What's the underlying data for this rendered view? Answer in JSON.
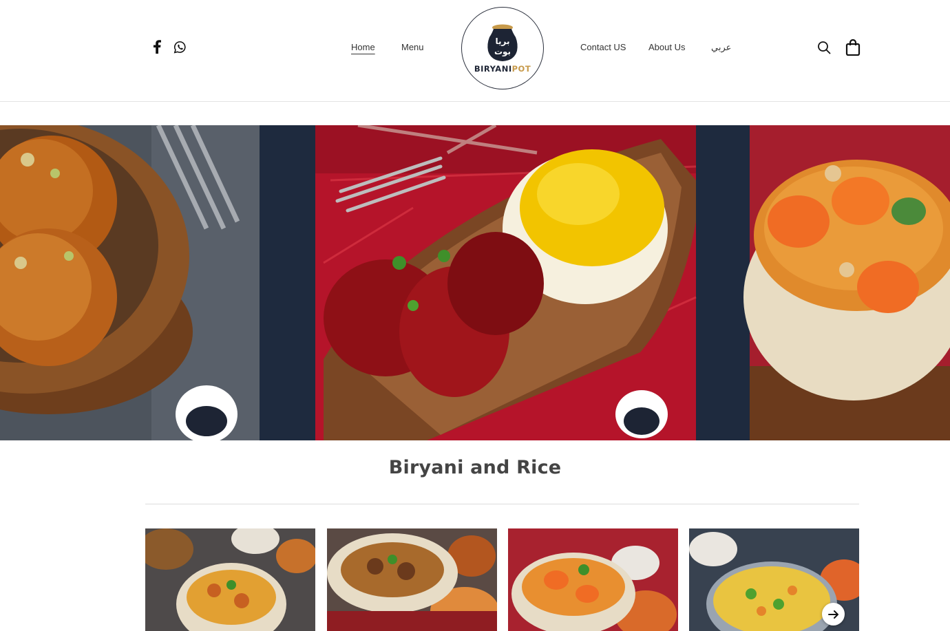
{
  "header": {
    "social": [
      {
        "icon": "facebook-icon"
      },
      {
        "icon": "whatsapp-icon"
      }
    ],
    "nav_left": [
      {
        "label": "Home",
        "active": true
      },
      {
        "label": "Menu",
        "active": false
      }
    ],
    "nav_right": [
      {
        "label": "Contact US"
      },
      {
        "label": "About Us"
      },
      {
        "label": "عربي"
      }
    ],
    "logo": {
      "text_dark": "BIRYANI",
      "text_gold": "POT",
      "arabic": "برياني بوت"
    },
    "icons": [
      "search-icon",
      "shopping-bag-icon"
    ]
  },
  "hero": {
    "slides": [
      "gulab-jamun",
      "chicken-tikka-rice",
      "shrimp-biryani"
    ]
  },
  "section": {
    "title": "Biryani and Rice"
  },
  "cards": [
    {
      "name": "biryani-item-1"
    },
    {
      "name": "biryani-item-2"
    },
    {
      "name": "biryani-item-3"
    },
    {
      "name": "biryani-item-4"
    }
  ],
  "carousel": {
    "next_icon": "arrow-right-icon"
  },
  "colors": {
    "navy": "#1e2a3e",
    "gold": "#c79a4b",
    "text": "#333333"
  }
}
